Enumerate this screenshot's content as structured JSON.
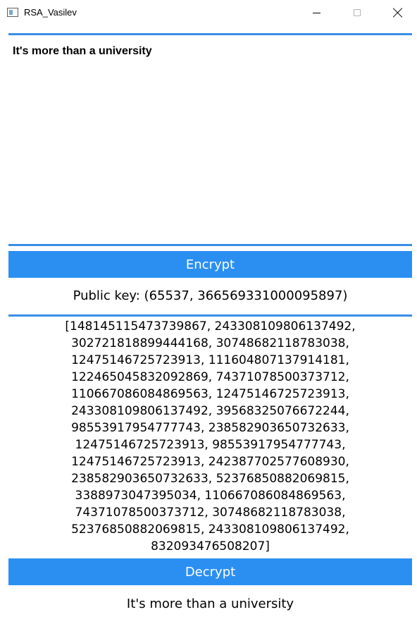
{
  "window": {
    "title": "RSA_Vasilev",
    "icon": "app-window-icon",
    "controls": {
      "minimize": "minimize-icon",
      "maximize": "maximize-icon",
      "close": "close-icon"
    }
  },
  "input": {
    "value": "It's more than a university"
  },
  "encrypt_button": {
    "label": "Encrypt"
  },
  "public_key": {
    "text": "Public key: (65537, 366569331000095897)"
  },
  "ciphertext": {
    "lines": [
      "[148145115473739867, 243308109806137492,",
      "302721818899444168, 30748682118783038,",
      "12475146725723913, 111604807137914181,",
      "122465045832092869, 74371078500373712,",
      "110667086084869563, 12475146725723913,",
      "243308109806137492, 39568325076672244,",
      "98553917954777743, 238582903650732633,",
      "12475146725723913, 98553917954777743,",
      "12475146725723913, 242387702577608930,",
      "238582903650732633, 52376850882069815,",
      "3388973047395034, 110667086084869563,",
      "74371078500373712, 30748682118783038,",
      "52376850882069815, 243308109806137492,",
      "832093476508207]"
    ]
  },
  "decrypt_button": {
    "label": "Decrypt"
  },
  "decrypted": {
    "text": "It's more than a university"
  },
  "colors": {
    "accent": "#2b8ff2",
    "divider": "#3a8ee6"
  }
}
